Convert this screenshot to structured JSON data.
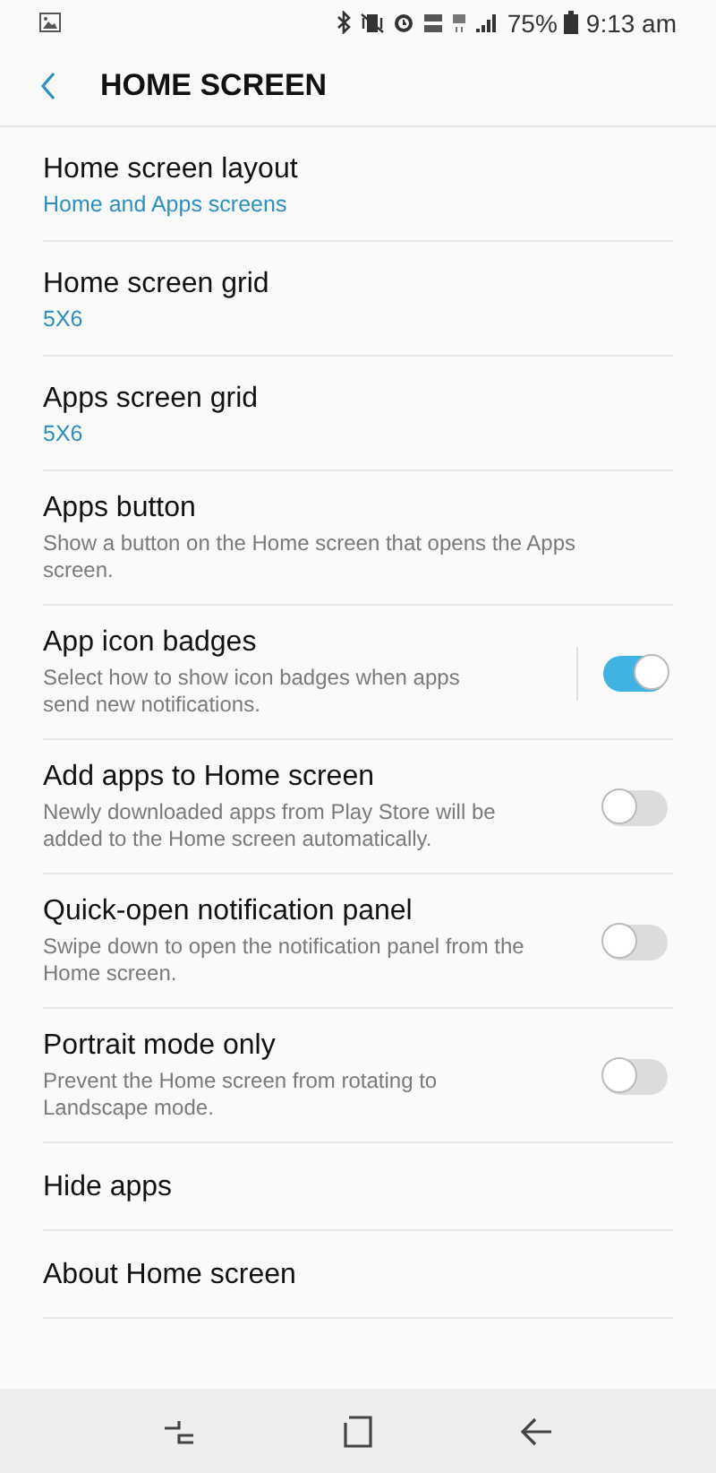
{
  "status_bar": {
    "battery": "75%",
    "time": "9:13 am"
  },
  "header": {
    "title": "HOME SCREEN"
  },
  "settings": [
    {
      "kind": "value",
      "title": "Home screen layout",
      "value": "Home and Apps screens"
    },
    {
      "kind": "value",
      "title": "Home screen grid",
      "value": "5X6"
    },
    {
      "kind": "value",
      "title": "Apps screen grid",
      "value": "5X6"
    },
    {
      "kind": "plain",
      "title": "Apps button",
      "description": "Show a button on the Home screen that opens the Apps screen."
    },
    {
      "kind": "toggle",
      "title": "App icon badges",
      "description": "Select how to show icon badges when apps send new notifications.",
      "on": true,
      "divider": true
    },
    {
      "kind": "toggle",
      "title": "Add apps to Home screen",
      "description": "Newly downloaded apps from Play Store will be added to the Home screen automatically.",
      "on": false,
      "divider": false
    },
    {
      "kind": "toggle",
      "title": "Quick-open notification panel",
      "description": "Swipe down to open the notification panel from the Home screen.",
      "on": false,
      "divider": false
    },
    {
      "kind": "toggle",
      "title": "Portrait mode only",
      "description": "Prevent the Home screen from rotating to Landscape mode.",
      "on": false,
      "divider": false
    },
    {
      "kind": "plain",
      "title": "Hide apps"
    },
    {
      "kind": "plain",
      "title": "About Home screen"
    }
  ]
}
